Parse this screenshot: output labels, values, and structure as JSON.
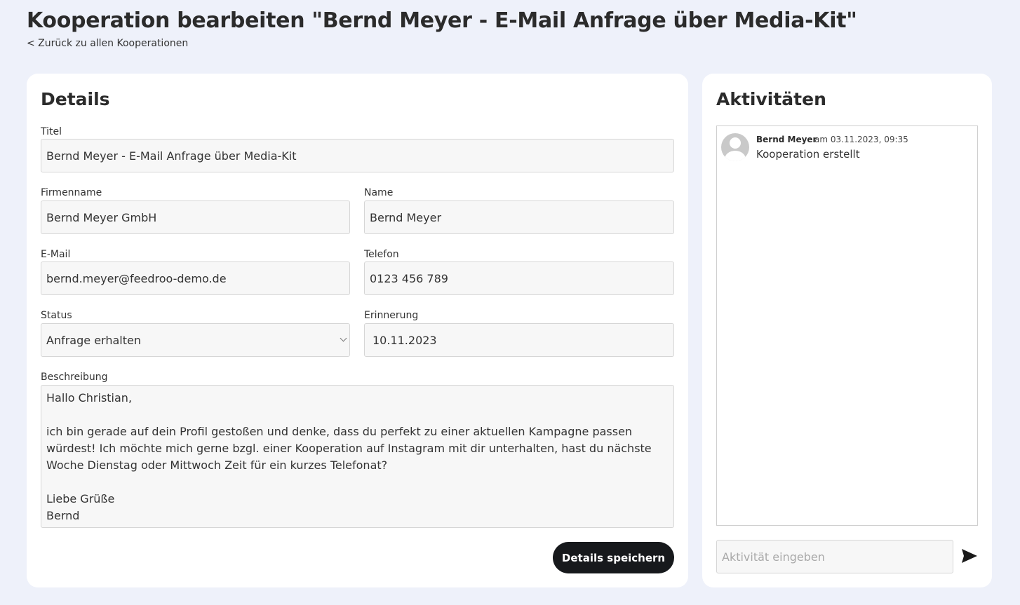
{
  "header": {
    "title": "Kooperation bearbeiten \"Bernd Meyer - E-Mail Anfrage über Media-Kit\"",
    "back_link": "< Zurück zu allen Kooperationen"
  },
  "details": {
    "heading": "Details",
    "title_label": "Titel",
    "title_value": "Bernd Meyer - E-Mail Anfrage über Media-Kit",
    "company_label": "Firmenname",
    "company_value": "Bernd Meyer GmbH",
    "name_label": "Name",
    "name_value": "Bernd Meyer",
    "email_label": "E-Mail",
    "email_value": "bernd.meyer@feedroo-demo.de",
    "phone_label": "Telefon",
    "phone_value": "0123 456 789",
    "status_label": "Status",
    "status_value": "Anfrage erhalten",
    "reminder_label": "Erinnerung",
    "reminder_value": "10.11.2023",
    "description_label": "Beschreibung",
    "description_value": "Hallo Christian,\n\nich bin gerade auf dein Profil gestoßen und denke, dass du perfekt zu einer aktuellen Kampagne passen würdest! Ich möchte mich gerne bzgl. einer Kooperation auf Instagram mit dir unterhalten, hast du nächste Woche Dienstag oder Mittwoch Zeit für ein kurzes Telefonat?\n\nLiebe Grüße\nBernd",
    "save_label": "Details speichern"
  },
  "activities": {
    "heading": "Aktivitäten",
    "items": [
      {
        "author": "Bernd Meyer",
        "date": "am 03.11.2023, 09:35",
        "text": "Kooperation erstellt",
        "avatar_icon": "user-avatar-icon"
      }
    ],
    "input_placeholder": "Aktivität eingeben",
    "send_icon": "send-icon"
  },
  "colors": {
    "background": "#eef1fa",
    "card": "#ffffff",
    "field_background": "#f7f7f7",
    "button": "#17191c"
  }
}
